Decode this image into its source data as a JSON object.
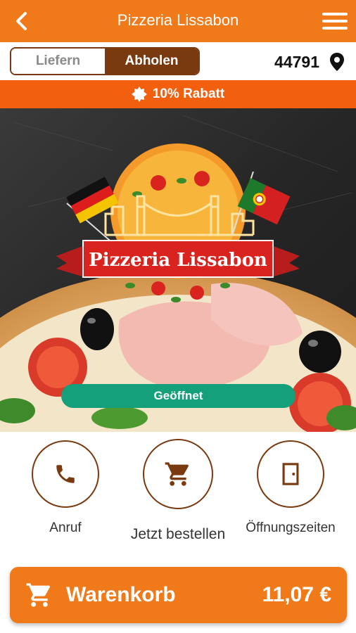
{
  "appbar": {
    "title": "Pizzeria Lissabon"
  },
  "mode": {
    "delivery_label": "Liefern",
    "pickup_label": "Abholen",
    "selected": "Abholen"
  },
  "location": {
    "postal_code": "44791"
  },
  "promo": {
    "text": "10% Rabatt"
  },
  "hero": {
    "logo_text": "Pizzeria Lissabon",
    "status": "Geöffnet"
  },
  "actions": [
    {
      "label": "Anruf",
      "icon": "phone-icon"
    },
    {
      "label": "Jetzt bestellen",
      "icon": "cart-icon"
    },
    {
      "label": "Öffnungszeiten",
      "icon": "door-icon"
    }
  ],
  "cart": {
    "label": "Warenkorb",
    "total": "11,07 €"
  },
  "colors": {
    "brand_orange": "#f07a1a",
    "promo_orange": "#f2600f",
    "brown": "#7a3a10",
    "open_green": "#13a07a"
  }
}
